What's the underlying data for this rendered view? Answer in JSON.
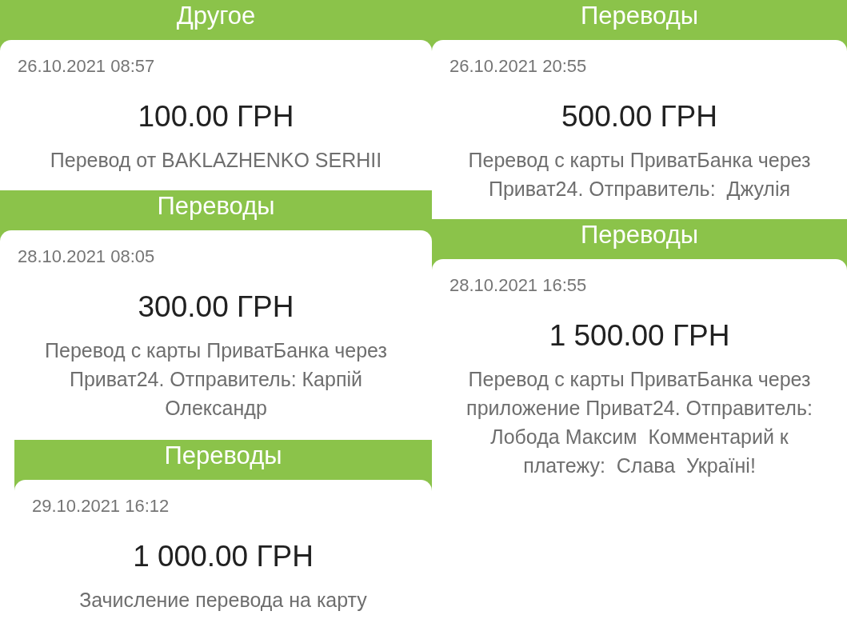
{
  "columns": [
    {
      "transactions": [
        {
          "category": "Другое",
          "date": "26.10.2021 08:57",
          "amount": "100.00 ГРН",
          "description": "Перевод от BAKLAZHENKO SERHII"
        },
        {
          "category": "Переводы",
          "date": "28.10.2021 08:05",
          "amount": "300.00 ГРН",
          "description": "Перевод с карты ПриватБанка через Приват24. Отправитель: Карпій Олександр"
        },
        {
          "category": "Переводы",
          "date": "29.10.2021 16:12",
          "amount": "1 000.00 ГРН",
          "description": "Зачисление перевода на карту"
        }
      ]
    },
    {
      "transactions": [
        {
          "category": "Переводы",
          "date": "26.10.2021 20:55",
          "amount": "500.00 ГРН",
          "description": "Перевод с карты ПриватБанка через Приват24. Отправитель:  Джулія"
        },
        {
          "category": "Переводы",
          "date": "28.10.2021 16:55",
          "amount": "1 500.00 ГРН",
          "description": "Перевод с карты ПриватБанка через приложение Приват24. Отправитель: Лобода Максим  Комментарий к платежу:  Слава  Україні!"
        }
      ]
    }
  ]
}
